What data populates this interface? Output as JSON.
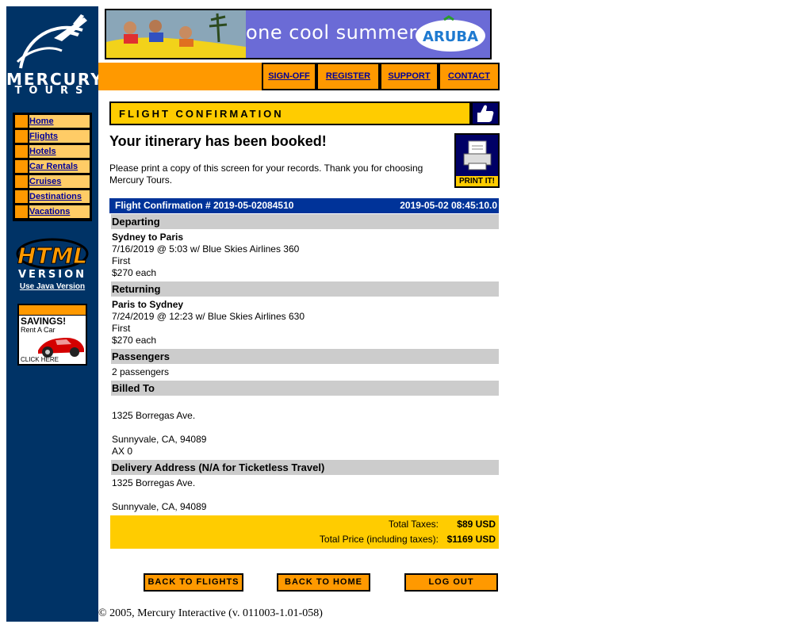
{
  "logo": {
    "brand": "MERCURY",
    "sub": "TOURS"
  },
  "nav": {
    "items": [
      {
        "label": "Home"
      },
      {
        "label": "Flights"
      },
      {
        "label": "Hotels"
      },
      {
        "label": "Car Rentals"
      },
      {
        "label": "Cruises"
      },
      {
        "label": "Destinations"
      },
      {
        "label": "Vacations"
      }
    ]
  },
  "html_version": {
    "badge_top": "HTML",
    "badge_bottom": "VERSION",
    "link": "Use Java Version"
  },
  "ad": {
    "title": "SAVINGS!",
    "sub": "Rent A Car",
    "click": "CLICK HERE"
  },
  "banner": {
    "text": "one cool summer",
    "brand": "ARUBA"
  },
  "menu": {
    "signoff": "SIGN-OFF",
    "register": "REGISTER",
    "support": "SUPPORT",
    "contact": "CONTACT"
  },
  "page": {
    "section_title": "FLIGHT CONFIRMATION",
    "heading": "Your itinerary has been booked!",
    "message": "Please print a copy of this screen for your records. Thank you for choosing Mercury Tours.",
    "print_label": "PRINT IT!"
  },
  "itinerary": {
    "confirmation": "Flight Confirmation # 2019-05-02084510",
    "timestamp": "2019-05-02 08:45:10.0",
    "departing": {
      "header": "Departing",
      "route": "Sydney to Paris",
      "details": "7/16/2019 @ 5:03 w/ Blue Skies Airlines 360",
      "class": "First",
      "price": "$270 each"
    },
    "returning": {
      "header": "Returning",
      "route": "Paris to Sydney",
      "details": "7/24/2019 @ 12:23 w/ Blue Skies Airlines 630",
      "class": "First",
      "price": "$270 each"
    },
    "passengers": {
      "header": "Passengers",
      "value": "2 passengers"
    },
    "billed_to": {
      "header": "Billed To",
      "street": "1325 Borregas Ave.",
      "city": "Sunnyvale, CA, 94089",
      "card": "AX 0"
    },
    "delivery": {
      "header": "Delivery Address (N/A for Ticketless Travel)",
      "street": "1325 Borregas Ave.",
      "city": "Sunnyvale, CA, 94089"
    },
    "totals": {
      "taxes_label": "Total Taxes:",
      "taxes_value": "$89 USD",
      "total_label": "Total Price (including taxes):",
      "total_value": "$1169 USD"
    }
  },
  "buttons": {
    "back_flights": "BACK TO FLIGHTS",
    "back_home": "BACK TO HOME",
    "logout": "LOG OUT"
  },
  "footer": "© 2005, Mercury Interactive (v. 011003-1.01-058)",
  "colors": {
    "sidebar": "#003366",
    "accent_orange": "#ff9900",
    "accent_yellow": "#ffcc00",
    "header_blue": "#003399",
    "link_blue": "#000099"
  }
}
